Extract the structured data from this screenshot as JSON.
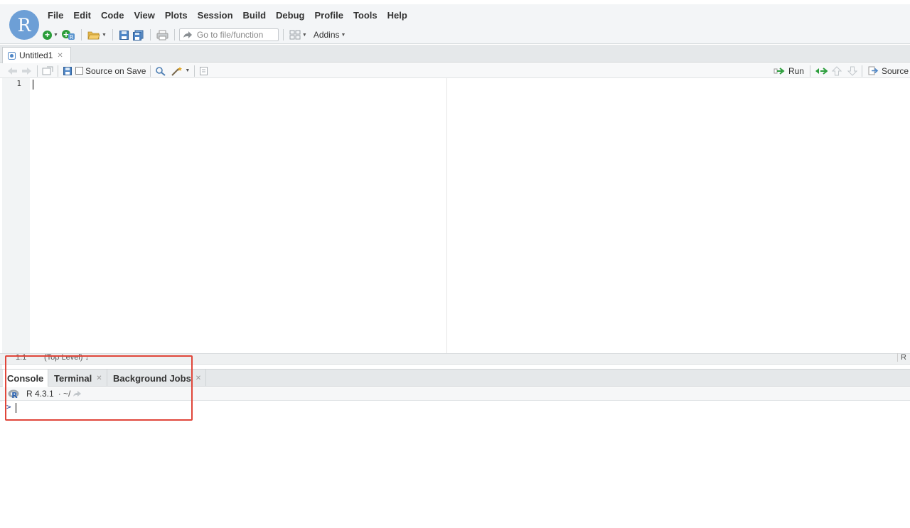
{
  "app": {
    "logo_letter": "R",
    "accent_color": "#6d9fd6",
    "highlight_color": "#e0463a"
  },
  "menubar": {
    "items": [
      "File",
      "Edit",
      "Code",
      "View",
      "Plots",
      "Session",
      "Build",
      "Debug",
      "Profile",
      "Tools",
      "Help"
    ]
  },
  "toolbar": {
    "new_file_icon": "new-file-icon",
    "goto_placeholder": "Go to file/function",
    "addins_label": "Addins"
  },
  "source": {
    "tab_label": "Untitled1",
    "source_on_save_label": "Source on Save",
    "run_label": "Run",
    "source_label": "Source",
    "line_number": "1"
  },
  "status": {
    "position": "1:1",
    "scope": "(Top Level) ↕",
    "file_type": "R Script"
  },
  "console": {
    "tabs": [
      "Console",
      "Terminal",
      "Background Jobs"
    ],
    "r_version": "R 4.3.1",
    "path": "· ~/",
    "prompt": ">"
  }
}
